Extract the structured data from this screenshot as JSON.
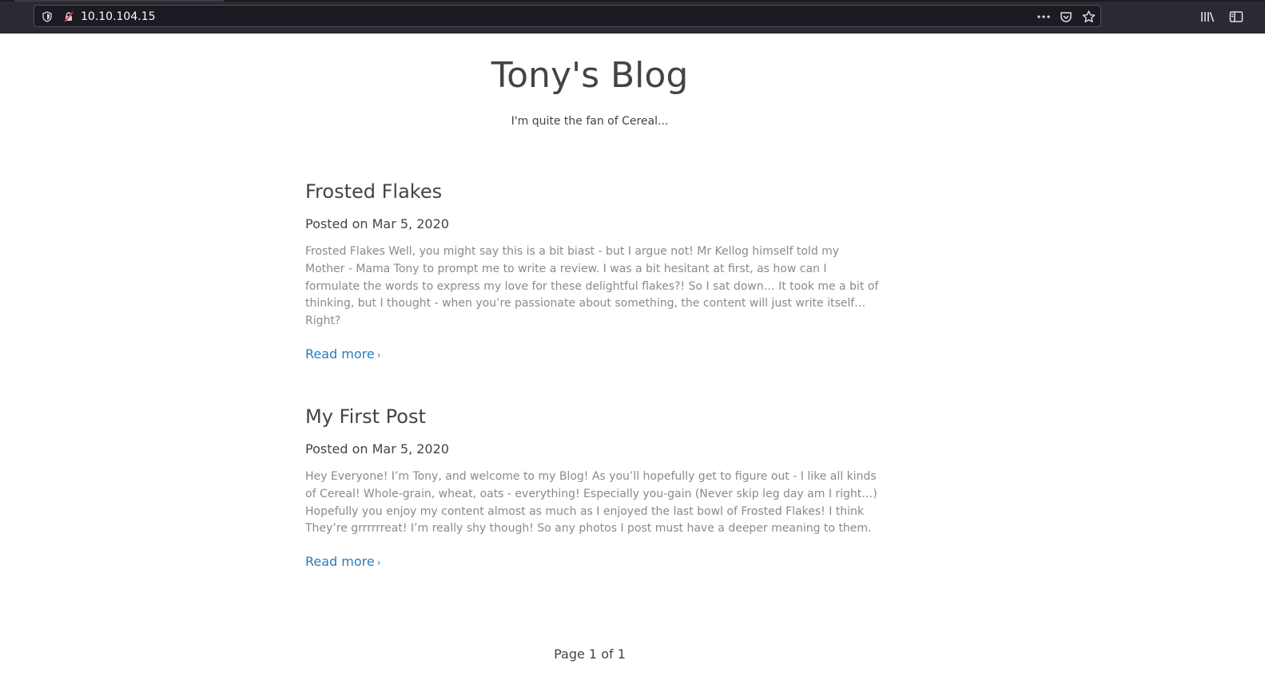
{
  "browser": {
    "url": "10.10.104.15",
    "icons": {
      "tracking": "shield-icon",
      "insecure": "insecure-lock-icon",
      "more": "more-actions-icon",
      "pocket": "pocket-icon",
      "bookmark": "bookmark-star-icon",
      "library": "library-icon",
      "sidebar": "sidebar-icon"
    }
  },
  "site": {
    "title": "Tony's Blog",
    "description": "I'm quite the fan of Cereal..."
  },
  "posts": [
    {
      "title": "Frosted Flakes",
      "meta": "Posted on Mar 5, 2020",
      "excerpt": "Frosted Flakes Well, you might say this is a bit biast - but I argue not! Mr Kellog himself told my Mother - Mama Tony to prompt me to write a review. I was a bit hesitant at first, as how can I formulate the words to express my love for these delightful flakes?! So I sat down… It took me a bit of thinking, but I thought - when you’re passionate about something, the content will just write itself… Right?",
      "read_more": "Read more",
      "chevron": "›"
    },
    {
      "title": "My First Post",
      "meta": "Posted on Mar 5, 2020",
      "excerpt": "Hey Everyone! I’m Tony, and welcome to my Blog! As you’ll hopefully get to figure out - I like all kinds of Cereal! Whole-grain, wheat, oats - everything! Especially you-gain (Never skip leg day am I right…) Hopefully you enjoy my content almost as much as I enjoyed the last bowl of Frosted Flakes! I think They’re grrrrrreat! I’m really shy though! So any photos I post must have a deeper meaning to them.",
      "read_more": "Read more",
      "chevron": "›"
    }
  ],
  "pagination": {
    "text": "Page 1 of 1"
  },
  "colors": {
    "toolbar": "#2b2a33",
    "link": "#2b7bb9",
    "text": "#444444",
    "excerpt": "#8a8a8a"
  }
}
